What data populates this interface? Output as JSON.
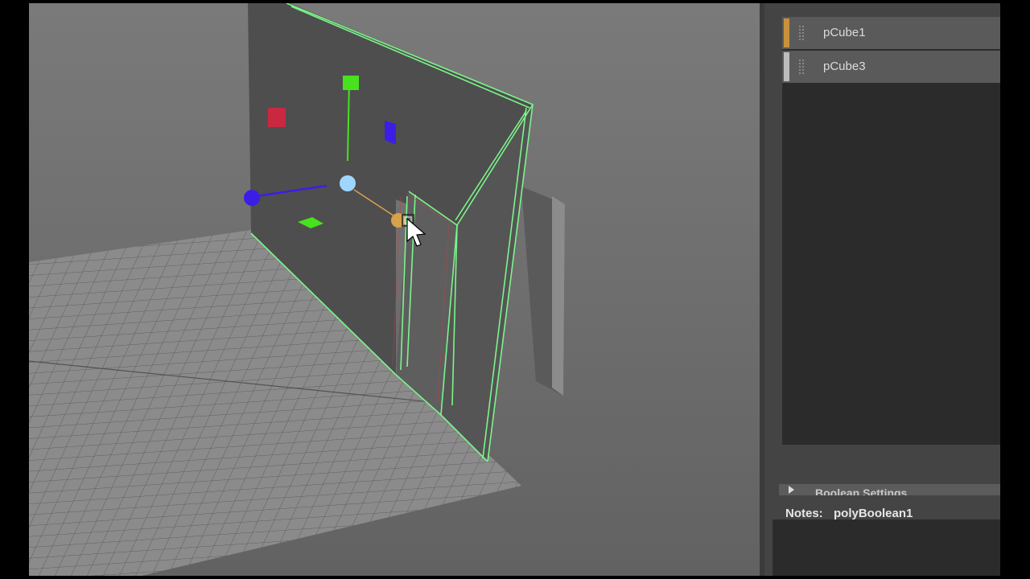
{
  "outliner": {
    "operands": [
      {
        "label": "pCube1",
        "color": "#c8913a"
      },
      {
        "label": "pCube3",
        "color": "#bdbdbd"
      }
    ]
  },
  "attributes": {
    "section_label": "Boolean Settings",
    "notes_label": "Notes:",
    "notes_value": "polyBoolean1"
  },
  "viewport": {
    "selection_color": "#7cf58a",
    "manipulator": {
      "x_handle_color": "#e0223f",
      "y_handle_color": "#48e11d",
      "z_handle_color": "#3b1ee6",
      "center_color": "#9fd6ff",
      "active_handle_color": "#d8a24a"
    }
  }
}
